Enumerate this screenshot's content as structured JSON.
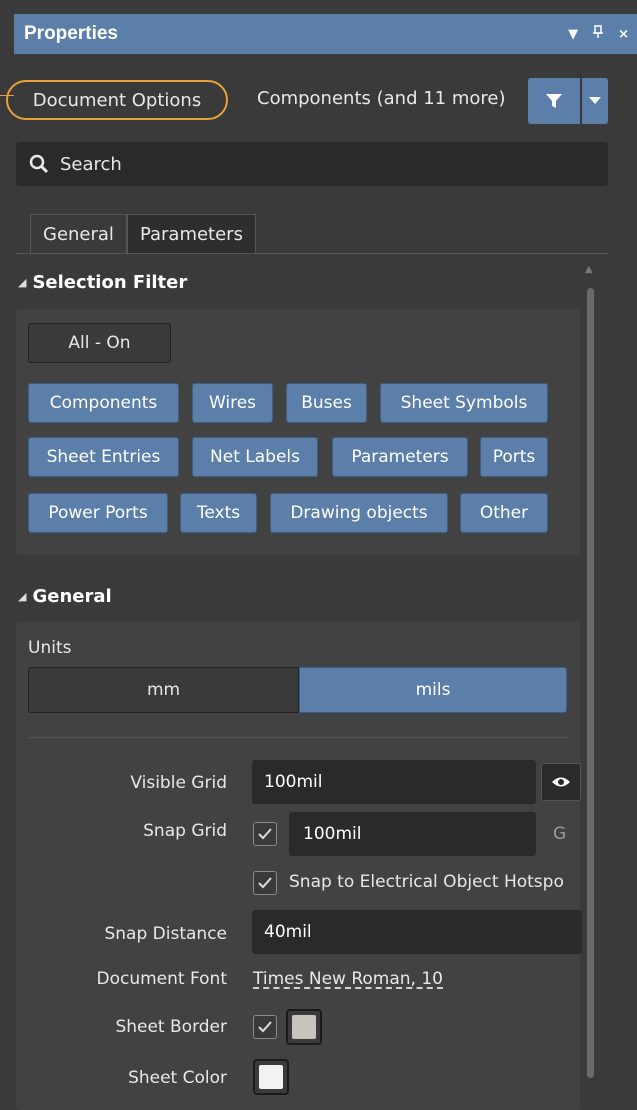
{
  "title": "Properties",
  "header_controls": [
    "▾",
    "pin-icon",
    "close-icon"
  ],
  "document_options": "Document Options",
  "components_link": "Components (and 11 more)",
  "search": {
    "placeholder": "Search"
  },
  "tabs": [
    {
      "label": "General",
      "active": true
    },
    {
      "label": "Parameters",
      "active": false
    }
  ],
  "selection_filter": {
    "heading": "Selection Filter",
    "all_on": "All - On",
    "chips": [
      "Components",
      "Wires",
      "Buses",
      "Sheet Symbols",
      "Sheet Entries",
      "Net Labels",
      "Parameters",
      "Ports",
      "Power Ports",
      "Texts",
      "Drawing objects",
      "Other"
    ]
  },
  "general": {
    "heading": "General",
    "units_label": "Units",
    "units": {
      "mm": "mm",
      "mils": "mils",
      "selected": "mils"
    },
    "visible_grid_label": "Visible Grid",
    "visible_grid_value": "100mil",
    "snap_grid_label": "Snap Grid",
    "snap_grid_value": "100mil",
    "snap_grid_shortcut": "G",
    "snap_hotspot_label": "Snap to Electrical Object Hotspo",
    "snap_distance_label": "Snap Distance",
    "snap_distance_value": "40mil",
    "document_font_label": "Document Font",
    "document_font_value": "Times New Roman, 10",
    "sheet_border_label": "Sheet Border",
    "sheet_color_label": "Sheet Color"
  },
  "colors": {
    "accent": "#5b7fa8",
    "callout": "#e8a23a",
    "sheet_border": "#c8c4bd",
    "sheet_color": "#f2f2f2"
  }
}
